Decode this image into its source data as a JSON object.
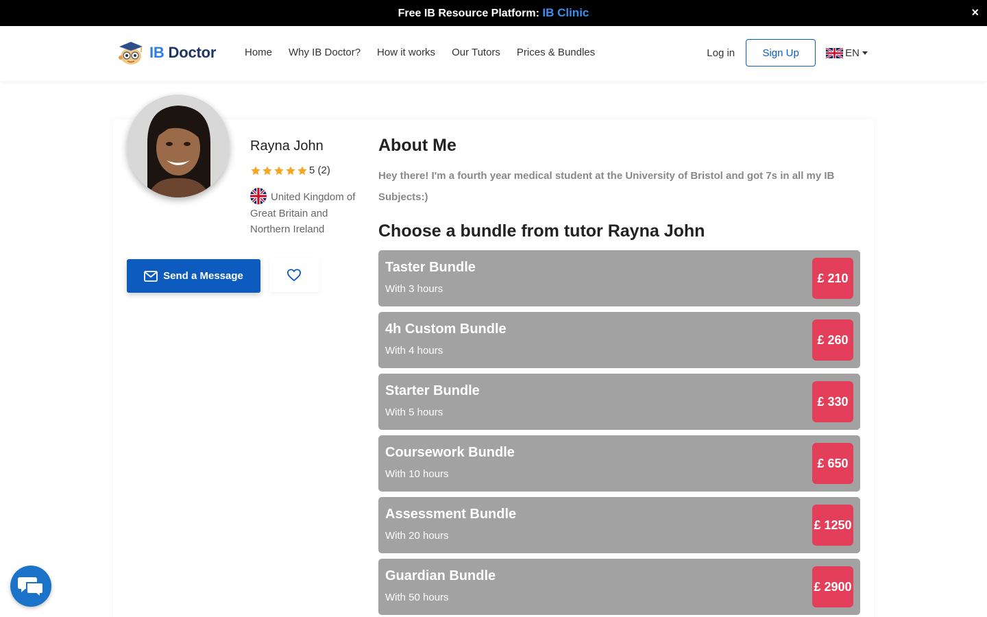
{
  "announcement": {
    "text": "Free IB Resource Platform: ",
    "link": "IB Clinic",
    "close": "×"
  },
  "brand": {
    "prefix": "IB",
    "name": "Doctor"
  },
  "nav": {
    "links": [
      "Home",
      "Why IB Doctor?",
      "How it works",
      "Our Tutors",
      "Prices & Bundles"
    ],
    "login": "Log in",
    "signup": "Sign Up",
    "language": "EN"
  },
  "tutor": {
    "name": "Rayna John",
    "rating_value": 5,
    "rating_text": "5 (2)",
    "country": "United Kingdom of Great Britain and Northern Ireland",
    "message_button": "Send a Message"
  },
  "about": {
    "title": "About Me",
    "text": "Hey there! I'm a fourth year medical student at the University of Bristol and got 7s in all my IB Subjects:)"
  },
  "bundles": {
    "title": "Choose a bundle from tutor Rayna John",
    "items": [
      {
        "name": "Taster Bundle",
        "hours": "With 3 hours",
        "price": "£ 210"
      },
      {
        "name": "4h Custom Bundle",
        "hours": "With 4 hours",
        "price": "£ 260"
      },
      {
        "name": "Starter Bundle",
        "hours": "With 5 hours",
        "price": "£ 330"
      },
      {
        "name": "Coursework Bundle",
        "hours": "With 10 hours",
        "price": "£ 650"
      },
      {
        "name": "Assessment Bundle",
        "hours": "With 20 hours",
        "price": "£ 1250"
      },
      {
        "name": "Guardian Bundle",
        "hours": "With 50 hours",
        "price": "£ 2900"
      }
    ]
  },
  "colors": {
    "primary": "#0d5bbf",
    "link_accent": "#3b8ef0",
    "price_badge": "#e43f5a",
    "bundle_card": "#a2a2a2",
    "star": "#f5a623",
    "chat": "#1a73c9"
  },
  "icons": {
    "close": "close-icon",
    "logo": "ib-doctor-logo",
    "flag_uk": "uk-flag-icon",
    "star": "star-icon",
    "envelope": "envelope-icon",
    "heart": "heart-icon",
    "chat": "chat-icon",
    "caret": "chevron-down-icon"
  }
}
